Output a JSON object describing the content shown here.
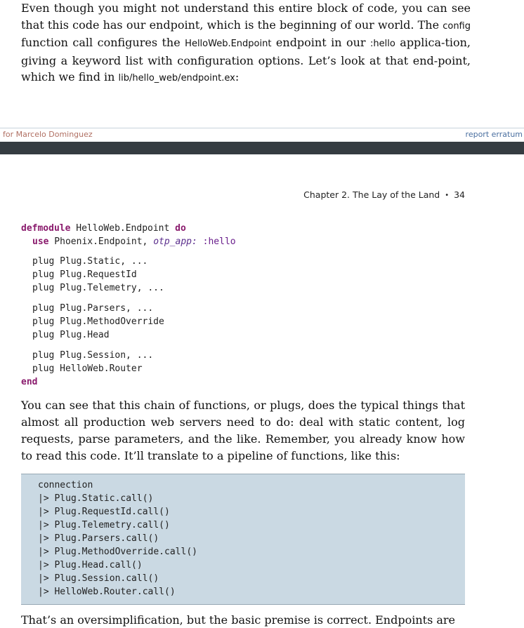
{
  "top_paragraph": {
    "t1": "Even though you might not understand this entire block of code, you can see that this code has our endpoint, which is the beginning of our world. The ",
    "code1": "config",
    "t2": " function call configures the ",
    "code2": "HelloWeb.Endpoint",
    "t3": " endpoint in our ",
    "code3": ":hello",
    "t4": " applica-tion, giving a keyword list with configuration options. Let’s look at that end-point, which we find in ",
    "code4": "lib/hello_web/endpoint.ex",
    "t5": ":"
  },
  "footer": {
    "left_text": "y for Marcelo Dominguez",
    "right_link": "report erratum"
  },
  "page_header": {
    "chapter": "Chapter 2. The Lay of the Land",
    "bullet": "•",
    "page_number": "34"
  },
  "code_block": {
    "l1_kw": "defmodule",
    "l1_mod": " HelloWeb.Endpoint ",
    "l1_do": "do",
    "l2_use": "use",
    "l2_mod": " Phoenix.Endpoint, ",
    "l2_key": "otp_app:",
    "l2_atom": " :hello",
    "l3": "plug Plug.Static, ...",
    "l4": "plug Plug.RequestId",
    "l5": "plug Plug.Telemetry, ...",
    "l6": "plug Plug.Parsers, ...",
    "l7": "plug Plug.MethodOverride",
    "l8": "plug Plug.Head",
    "l9": "plug Plug.Session, ...",
    "l10": "plug HelloWeb.Router",
    "l11": "end"
  },
  "middle_paragraph": "You can see that this chain of functions, or plugs, does the typical things that almost all production web servers need to do: deal with static content, log requests, parse parameters, and the like. Remember, you already know how to read this code. It’ll translate to a pipeline of functions, like this:",
  "pipeline": [
    "connection",
    "|> Plug.Static.call()",
    "|> Plug.RequestId.call()",
    "|> Plug.Telemetry.call()",
    "|> Plug.Parsers.call()",
    "|> Plug.MethodOverride.call()",
    "|> Plug.Head.call()",
    "|> Plug.Session.call()",
    "|> HelloWeb.Router.call()"
  ],
  "cut_paragraph": "That’s an oversimplification, but the basic premise is correct. Endpoints are"
}
